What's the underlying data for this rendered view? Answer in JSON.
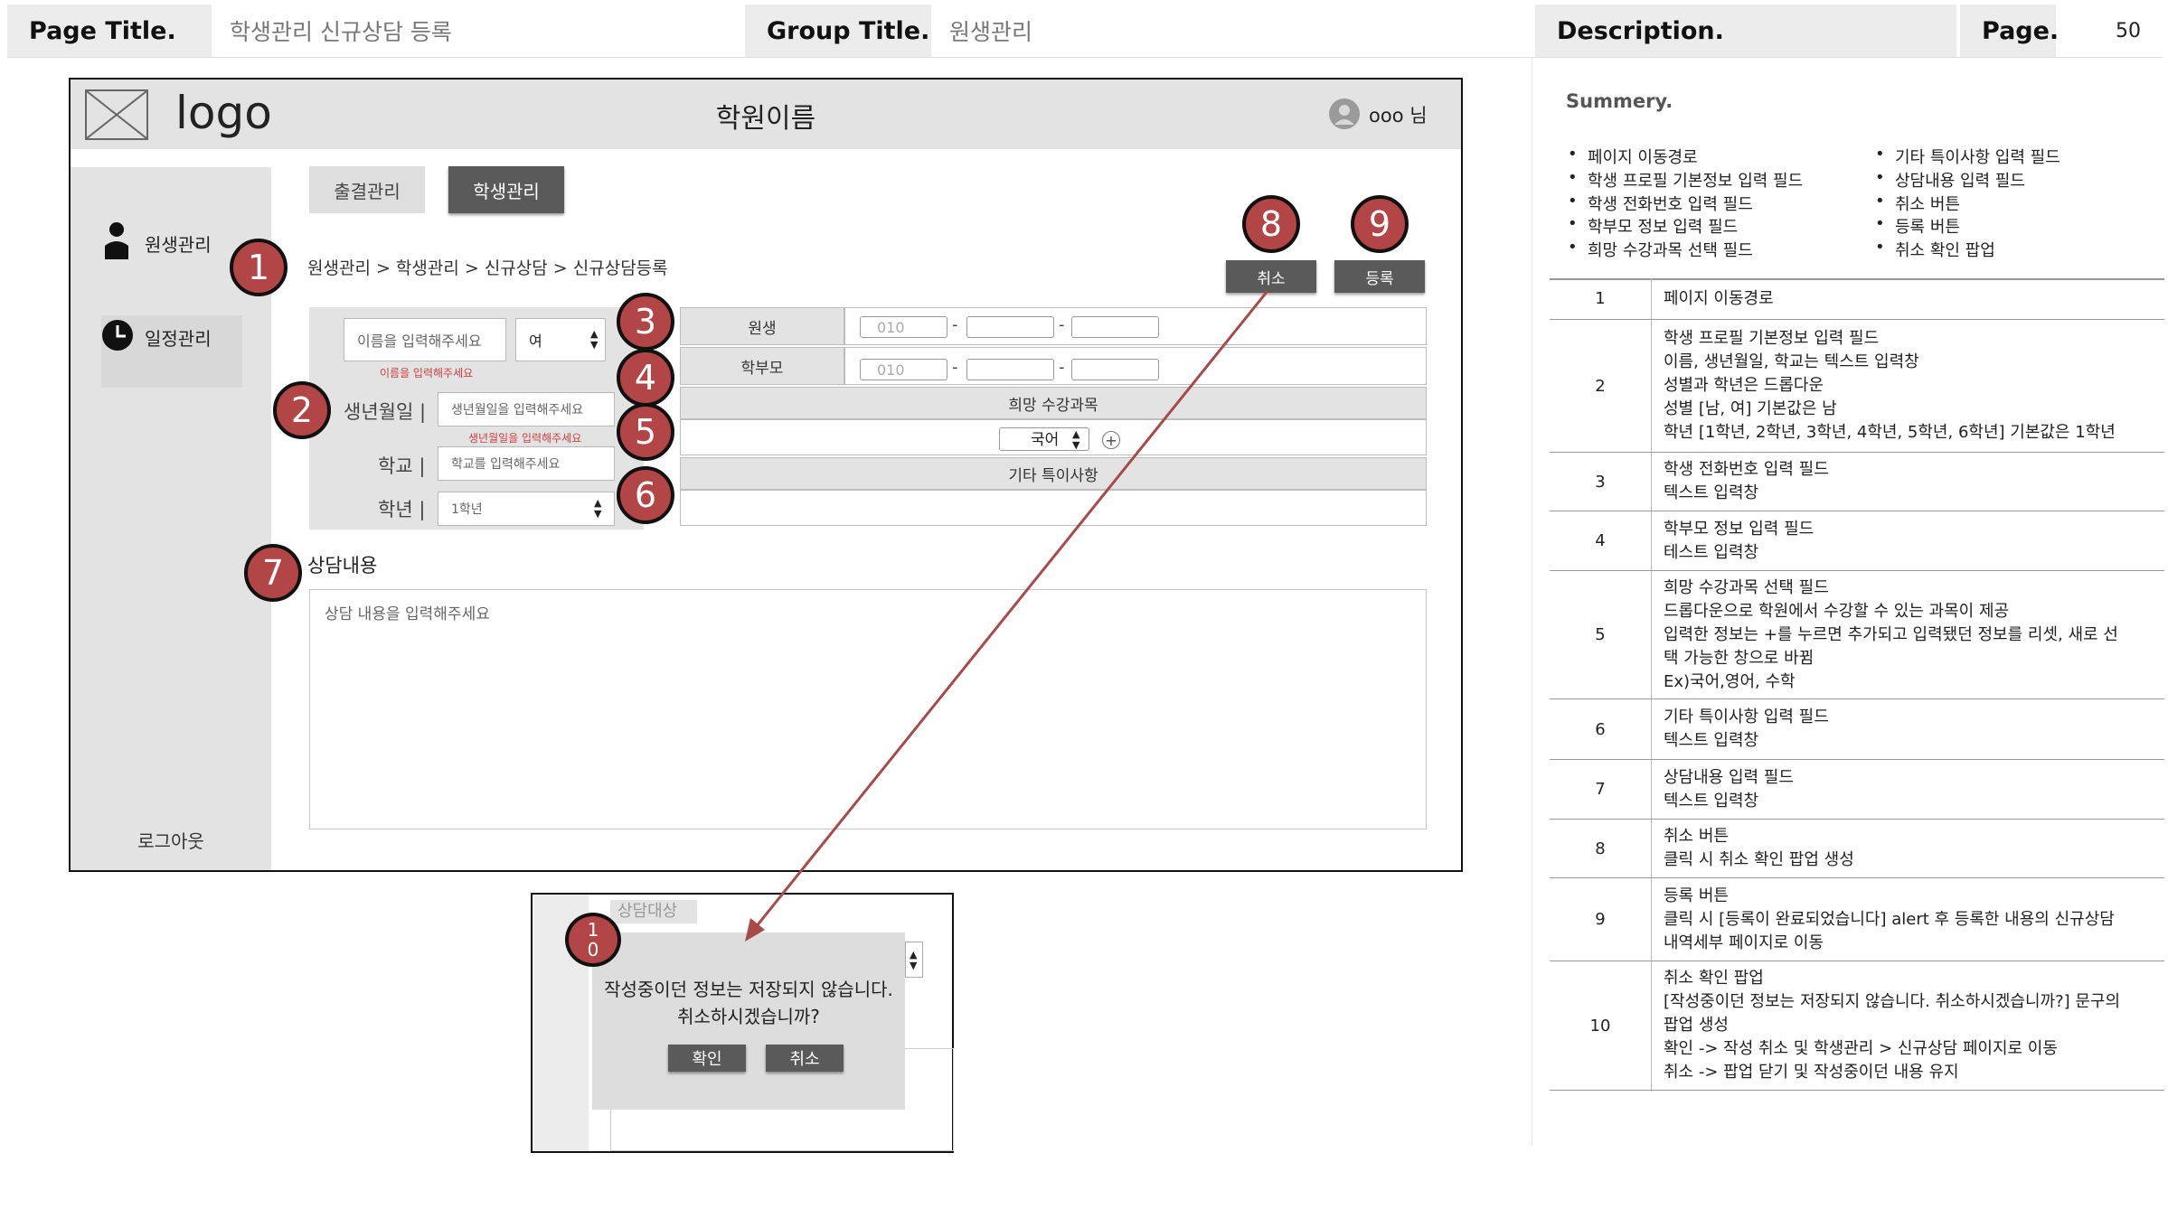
{
  "header": {
    "page_title_label": "Page Title.",
    "page_title_value": "학생관리 신규상담 등록",
    "group_title_label": "Group Title.",
    "group_title_value": "원생관리",
    "description_label": "Description.",
    "page_label": "Page.",
    "page_value": "50"
  },
  "wireframe": {
    "logo_text": "logo",
    "academy_name": "학원이름",
    "user_name": "ooo 님",
    "sidebar": {
      "items": [
        {
          "label": "원생관리",
          "icon": "person-icon"
        },
        {
          "label": "일정관리",
          "icon": "clock-icon"
        }
      ],
      "logout": "로그아웃"
    },
    "tabs": [
      {
        "label": "출결관리",
        "active": false
      },
      {
        "label": "학생관리",
        "active": true
      }
    ],
    "breadcrumb": "원생관리 > 학생관리 > 신규상담 > 신규상담등록",
    "buttons": {
      "cancel": "취소",
      "register": "등록"
    },
    "profile": {
      "name_placeholder": "이름을 입력해주세요",
      "name_error": "이름을 입력해주세요",
      "gender_value": "여",
      "birth_label": "생년월일 |",
      "birth_placeholder": "생년월일을 입력해주세요",
      "birth_error": "생년월일을 입력해주세요",
      "school_label": "학교 |",
      "school_placeholder": "학교를 입력해주세요",
      "grade_label": "학년 |",
      "grade_value": "1학년"
    },
    "phone": {
      "student_label": "원생",
      "parent_label": "학부모",
      "prefix_placeholder": "010",
      "separator": "-"
    },
    "course": {
      "label": "희망 수강과목",
      "value": "국어",
      "add": "+"
    },
    "other_notes_label": "기타 특이사항",
    "consult": {
      "label": "상담내용",
      "placeholder": "상담 내용을 입력해주세요"
    },
    "markers": [
      "1",
      "2",
      "3",
      "4",
      "5",
      "6",
      "7",
      "8",
      "9"
    ]
  },
  "popup": {
    "bg_label": "상담대상",
    "marker": "10",
    "message_line1": "작성중이던 정보는 저장되지 않습니다.",
    "message_line2": "취소하시겠습니까?",
    "confirm": "확인",
    "cancel": "취소"
  },
  "description": {
    "summary_title": "Summery.",
    "summary_left": [
      "페이지 이동경로",
      "학생 프로필 기본정보 입력 필드",
      "학생 전화번호 입력 필드",
      "학부모 정보 입력 필드",
      "희망 수강과목 선택 필드"
    ],
    "summary_right": [
      "기타 특이사항 입력 필드",
      "상담내용 입력 필드",
      "취소 버튼",
      "등록 버튼",
      "취소 확인 팝업"
    ],
    "rows": [
      {
        "num": "1",
        "lines": [
          "페이지 이동경로"
        ]
      },
      {
        "num": "2",
        "lines": [
          "학생 프로필 기본정보 입력 필드",
          "이름, 생년월일, 학교는 텍스트 입력창",
          "성별과 학년은 드롭다운",
          "성별 [남, 여] 기본값은 남",
          "학년 [1학년, 2학년, 3학년, 4학년, 5학년, 6학년] 기본값은 1학년"
        ]
      },
      {
        "num": "3",
        "lines": [
          "학생 전화번호 입력 필드",
          "텍스트 입력창"
        ]
      },
      {
        "num": "4",
        "lines": [
          "학부모 정보 입력 필드",
          "테스트 입력창"
        ]
      },
      {
        "num": "5",
        "lines": [
          "희망 수강과목 선택 필드",
          "드롭다운으로 학원에서 수강할 수 있는 과목이 제공",
          "입력한 정보는 +를 누르면 추가되고 입력됐던 정보를 리셋, 새로 선",
          "택 가능한 창으로 바뀜",
          "Ex)국어,영어, 수학"
        ]
      },
      {
        "num": "6",
        "lines": [
          "기타 특이사항 입력 필드",
          "텍스트 입력창"
        ]
      },
      {
        "num": "7",
        "lines": [
          "상담내용 입력 필드",
          "텍스트 입력창"
        ]
      },
      {
        "num": "8",
        "lines": [
          "취소 버튼",
          "클릭 시 취소 확인 팝업 생성"
        ]
      },
      {
        "num": "9",
        "lines": [
          "등록 버튼",
          "클릭 시 [등록이 완료되었습니다] alert 후 등록한 내용의 신규상담",
          "내역세부 페이지로 이동"
        ]
      },
      {
        "num": "10",
        "lines": [
          "취소 확인 팝업",
          "[작성중이던 정보는 저장되지 않습니다. 취소하시겠습니까?] 문구의",
          "팝업 생성",
          "확인 -> 작성 취소 및 학생관리 > 신규상담 페이지로 이동",
          "취소 -> 팝업 닫기 및 작성중이던 내용 유지"
        ]
      }
    ]
  },
  "colors": {
    "marker_red": "#b24545",
    "arrow": "#a84a4a",
    "panel_gray": "#e3e3e3",
    "button_dark": "#5a5a5a"
  }
}
